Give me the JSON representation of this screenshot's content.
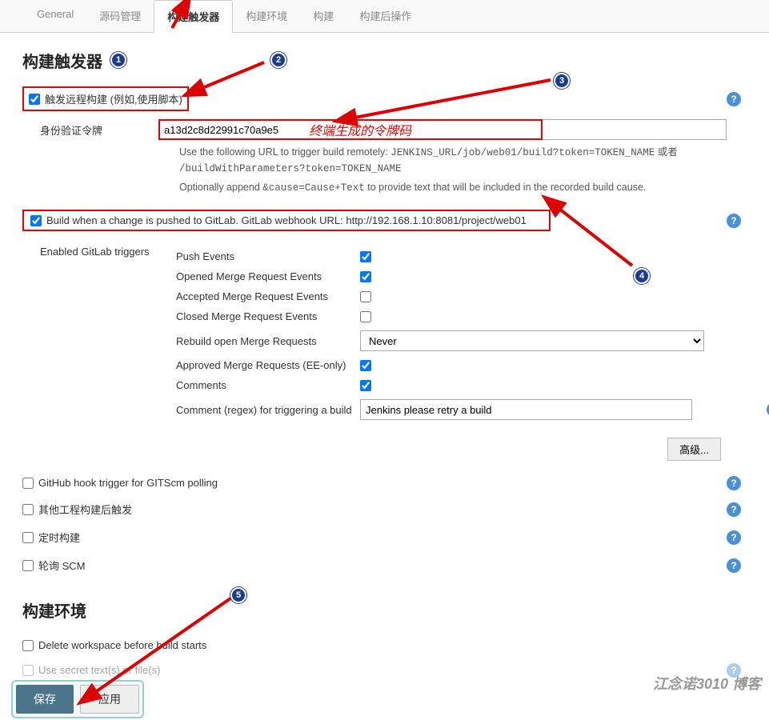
{
  "tabs": {
    "general": "General",
    "scm": "源码管理",
    "triggers": "构建触发器",
    "env": "构建环境",
    "build": "构建",
    "post": "构建后操作"
  },
  "section_triggers_title": "构建触发器",
  "remote_trigger": {
    "label": "触发远程构建 (例如,使用脚本)",
    "auth_token_label": "身份验证令牌",
    "auth_token_value": "a13d2c8d22991c70a9e5",
    "anno": "终端生成的令牌码",
    "help1_a": "Use the following URL to trigger build remotely: ",
    "help1_b": "JENKINS_URL/job/web01/build?token=TOKEN_NAME",
    "help1_c": " 或者 ",
    "help1_d": "/buildWithParameters?token=TOKEN_NAME",
    "help2_a": "Optionally append ",
    "help2_b": "&cause=Cause+Text",
    "help2_c": " to provide text that will be included in the recorded build cause."
  },
  "gitlab_trigger": {
    "label": "Build when a change is pushed to GitLab. GitLab webhook URL: http://192.168.1.10:8081/project/web01",
    "enabled_label": "Enabled GitLab triggers",
    "push": "Push Events",
    "opened_mr": "Opened Merge Request Events",
    "accepted_mr": "Accepted Merge Request Events",
    "closed_mr": "Closed Merge Request Events",
    "rebuild_mr": "Rebuild open Merge Requests",
    "rebuild_value": "Never",
    "approved_mr": "Approved Merge Requests (EE-only)",
    "comments": "Comments",
    "comment_regex_label": "Comment (regex) for triggering a build",
    "comment_regex_value": "Jenkins please retry a build",
    "advanced_btn": "高级..."
  },
  "other_checks": {
    "github_hook": "GitHub hook trigger for GITScm polling",
    "other_proj": "其他工程构建后触发",
    "timed": "定时构建",
    "poll_scm": "轮询 SCM"
  },
  "section_env_title": "构建环境",
  "env_checks": {
    "delete_ws": "Delete workspace before build starts",
    "secret": "Use secret text(s) or file(s)"
  },
  "buttons": {
    "save": "保存",
    "apply": "应用"
  },
  "watermark": "江念诺3010 博客"
}
